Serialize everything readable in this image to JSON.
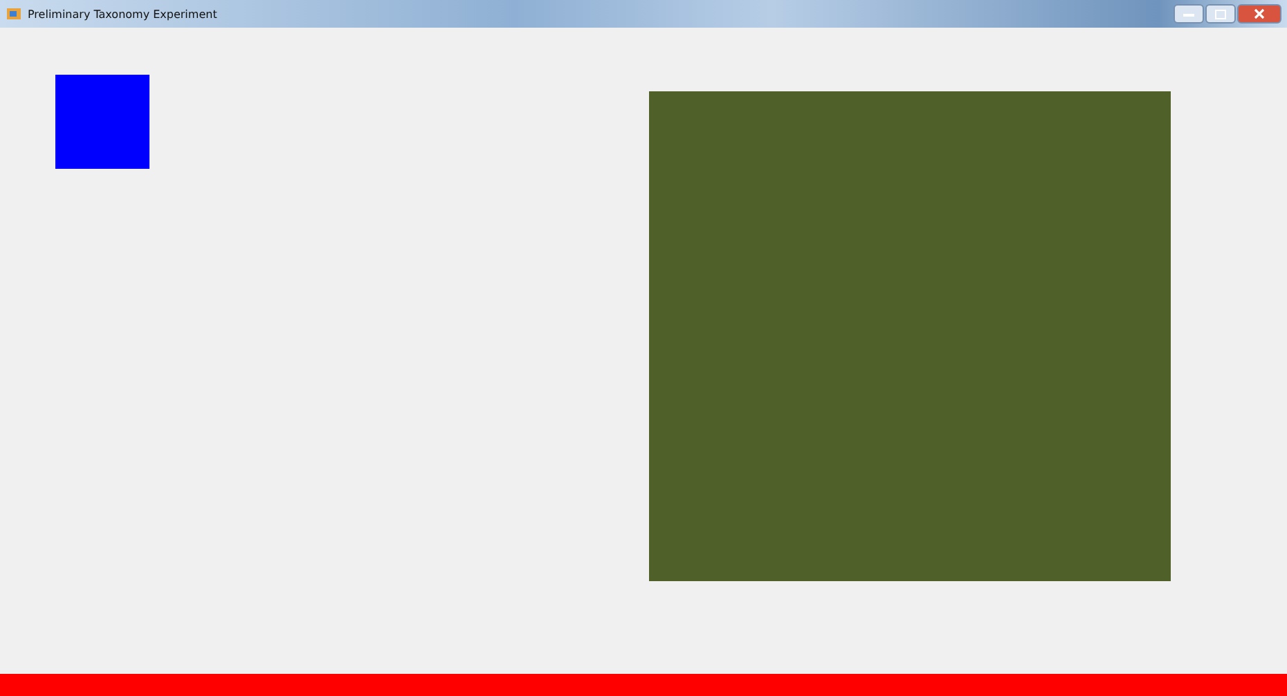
{
  "window": {
    "title": "Preliminary Taxonomy Experiment"
  },
  "shapes": [
    {
      "kind": "square",
      "color": "#0000ff"
    },
    {
      "kind": "panel",
      "color": "#4f6028"
    }
  ],
  "footer_bar": {
    "color": "#ff0000"
  }
}
